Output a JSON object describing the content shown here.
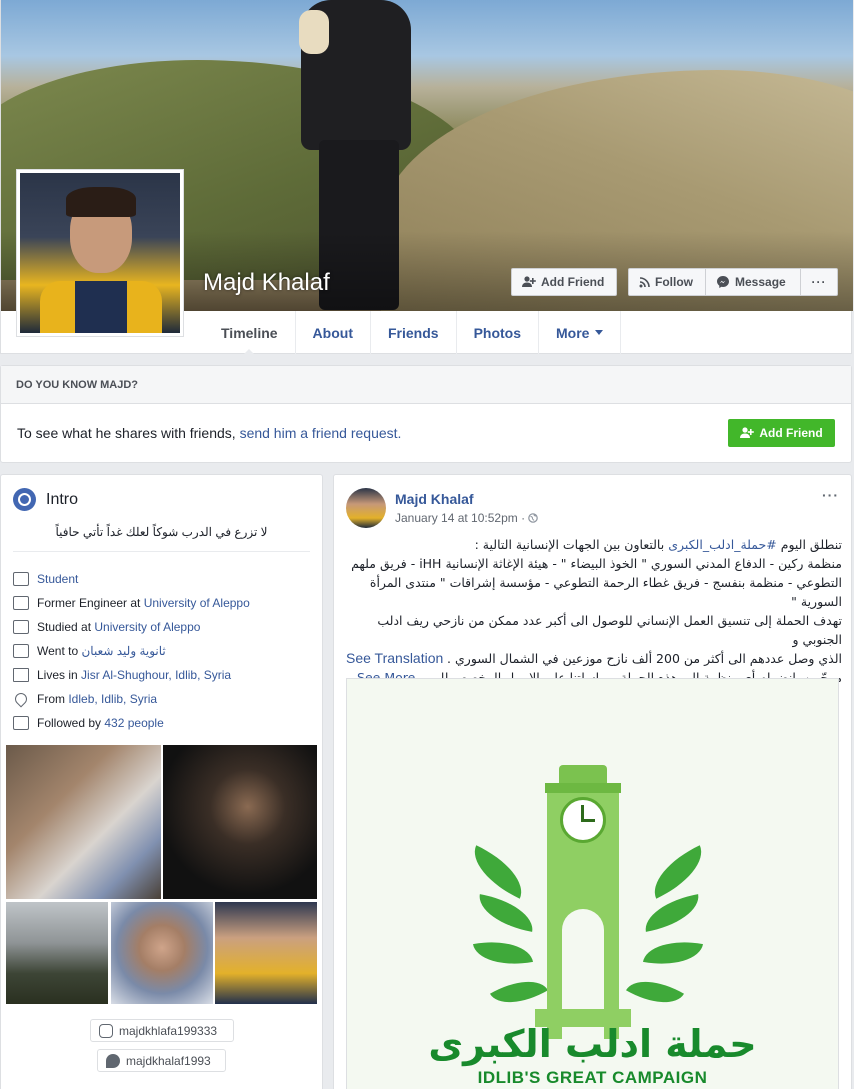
{
  "profile": {
    "name": "Majd Khalaf"
  },
  "cover_actions": {
    "add_friend": "Add Friend",
    "follow": "Follow",
    "message": "Message",
    "more": "···"
  },
  "nav": {
    "tabs": [
      {
        "label": "Timeline",
        "active": true
      },
      {
        "label": "About"
      },
      {
        "label": "Friends"
      },
      {
        "label": "Photos"
      },
      {
        "label": "More"
      }
    ]
  },
  "know": {
    "title": "DO YOU KNOW MAJD?",
    "text": "To see what he shares with friends,",
    "link": "send him a friend request.",
    "button": "Add Friend"
  },
  "intro": {
    "title": "Intro",
    "bio": "لا تزرع في الدرب شوكاً لعلك غداً تأتي حافياً",
    "items": [
      {
        "icon": "briefcase-icon",
        "prefix": "",
        "link": "Student"
      },
      {
        "icon": "briefcase-icon",
        "prefix": "Former Engineer at ",
        "link": "University of Aleppo"
      },
      {
        "icon": "graduation-cap-icon",
        "prefix": "Studied at ",
        "link": "University of Aleppo"
      },
      {
        "icon": "graduation-cap-icon",
        "prefix": "Went to ",
        "link": "ثانوية وليد شعبان"
      },
      {
        "icon": "house-icon",
        "prefix": "Lives in ",
        "link": "Jisr Al-Shughour, Idlib, Syria"
      },
      {
        "icon": "location-pin-icon",
        "prefix": "From ",
        "link": "Idleb, Idlib, Syria"
      },
      {
        "icon": "rss-feed-icon",
        "prefix": "Followed by ",
        "link": "432 people"
      }
    ],
    "instagram": "majdkhlafa199333",
    "twitter": "majdkhalaf1993"
  },
  "post": {
    "author": "Majd Khalaf",
    "time": "January 14 at 10:52pm · ",
    "privacy_icon": "globe-icon",
    "hashtag": "#حملة_ادلب_الكبرى",
    "line1_prefix": "تنطلق اليوم ",
    "line1_suffix": " بالتعاون بين الجهات الإنسانية التالية :",
    "line2": "منظمة ركين - الدفاع المدني السوري \" الخوذ البيضاء \" - هيئة الإغاثة الإنسانية iHH - فريق ملهم",
    "line3": "التطوعي - منظمة بنفسج - فريق غطاء الرحمة التطوعي - مؤسسة إشراقات \" منتدى المرأة السورية \"",
    "line4": "تهدف الحملة إلى تنسيق العمل الإنساني للوصول الى أكبر عدد ممكن من نازحي ريف ادلب الجنوبي و",
    "line5": "الذي وصل عددهم الى أكثر من 200 ألف نازح موزعين في الشمال السوري .",
    "line6": "مرحّبين بانضمام أي منظمة الى هذه الحملة بمراسلتنا على الايميل المخصص لل ...",
    "see_more": "See More",
    "see_translation": "See Translation",
    "image_title_ar": "حملة ادلب الكبرى",
    "image_title_en": "IDLIB'S GREAT CAMPAIGN"
  },
  "colors": {
    "link": "#365899",
    "green_button": "#42b72a",
    "campaign_green": "#188a2c"
  }
}
